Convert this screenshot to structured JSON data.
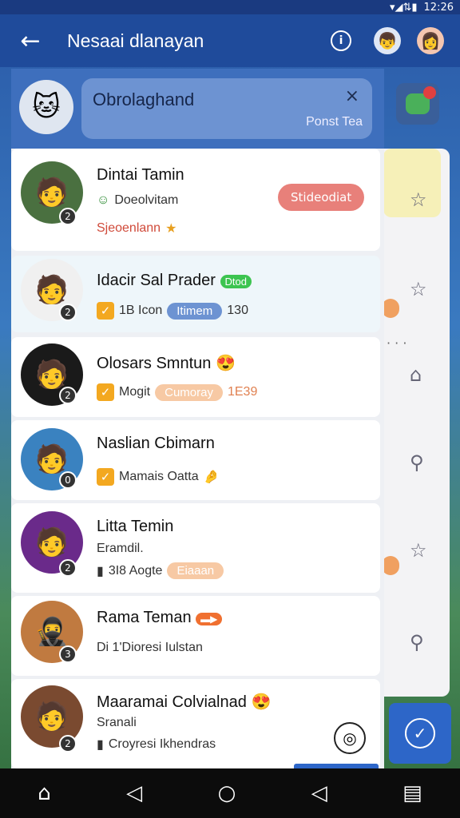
{
  "status": {
    "time": "12:26",
    "icons": "▾◢⇅▮"
  },
  "appbar": {
    "back_icon": "←",
    "title": "Nesaai dlanayan",
    "info_icon": "i"
  },
  "search": {
    "value": "Obrolaghand",
    "clear": "×",
    "hint": "Ponst Tea"
  },
  "right_panel": {
    "stars": [
      "☆",
      "☆",
      "⌂",
      "⚲",
      "☆",
      "⚲"
    ],
    "dots": "· · ·"
  },
  "list": [
    {
      "name": "Dintai Tamin",
      "badge": "2",
      "line1_icon": "☺",
      "line1": "Doeolvitam",
      "line2": "Sjeoenlann",
      "pill": "Stideodiat",
      "pill_color": "#e8807a"
    },
    {
      "name": "Idacir Sal Prader",
      "tag": "Dtod",
      "badge": "2",
      "line1": "1B  Icon",
      "pill": "Itimem",
      "extra": "130"
    },
    {
      "name": "Olosars Smntun",
      "badge": "2",
      "line1": "Mogit",
      "pill": "Cumoray",
      "extra": "1E39"
    },
    {
      "name": "Naslian Cbimarn",
      "badge": "0",
      "line1": "Mamais Oatta"
    },
    {
      "name": "Litta Temin",
      "badge": "2",
      "line1": "Eramdil.",
      "line2": "3I8 Aogte",
      "pill": "Eiaaan"
    },
    {
      "name": "Rama Teman",
      "badge": "3",
      "line1": "Di  1'Dioresi Iulstan"
    },
    {
      "name": "Maaramai Colvialnad",
      "badge": "2",
      "line1": "Sranali",
      "line2": "Croyresi Ikhendras",
      "fab": "◎"
    }
  ],
  "nav": {
    "home": "⌂",
    "back": "◁",
    "circle": "○",
    "back2": "◁",
    "menu": "▤"
  }
}
